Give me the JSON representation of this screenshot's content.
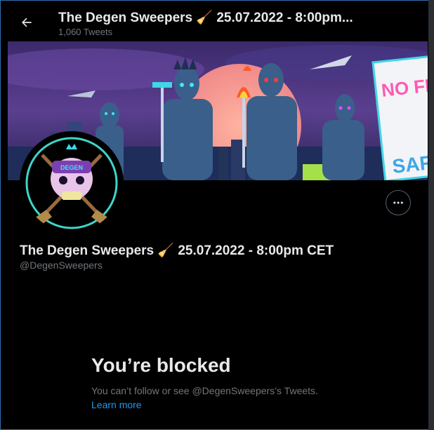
{
  "header": {
    "title": "The Degen Sweepers 🧹 25.07.2022 - 8:00pm...",
    "tweets_count": "1,060 Tweets"
  },
  "profile": {
    "display_name": "The Degen Sweepers 🧹 25.07.2022 - 8:00pm CET",
    "handle": "@DegenSweepers",
    "avatar_text": "DEGEN"
  },
  "banner": {
    "sign_text_1": "NO FL",
    "sign_text_2": "SAF"
  },
  "blocked": {
    "title": "You’re blocked",
    "message": "You can’t follow or see @DegenSweepers’s Tweets.",
    "learn_more": "Learn more"
  },
  "colors": {
    "background": "#000000",
    "link": "#1d9bf0",
    "secondary_text": "#71767b"
  }
}
